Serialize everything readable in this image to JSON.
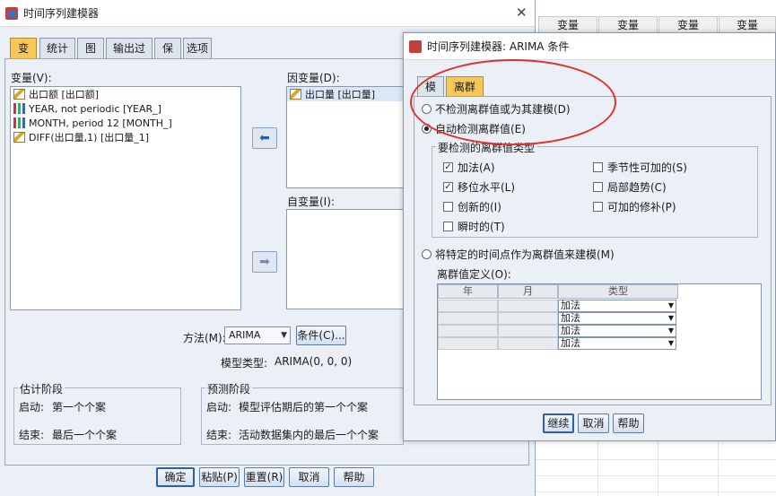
{
  "background_sheet": {
    "columns": [
      "变量",
      "变量",
      "变量",
      "变量"
    ]
  },
  "main_dialog": {
    "title": "时间序列建模器",
    "tabs": [
      "变量",
      "统计量",
      "图表",
      "输出过滤",
      "保存",
      "选项"
    ],
    "variables_label": "变量(V):",
    "variables": [
      {
        "icon": "scale-icon",
        "label": "出口额 [出口额]"
      },
      {
        "icon": "nominal-bars-icon",
        "label": "YEAR, not periodic [YEAR_]"
      },
      {
        "icon": "nominal-bars-icon",
        "label": "MONTH, period 12 [MONTH_]"
      },
      {
        "icon": "scale-icon",
        "label": "DIFF(出口量,1) [出口量_1]"
      }
    ],
    "dependent_label": "因变量(D):",
    "dependent_items": [
      "出口量 [出口量]"
    ],
    "independent_label": "自变量(I):",
    "method_label": "方法(M):",
    "method_value": "ARIMA",
    "criteria_button": "条件(C)...",
    "model_type_label": "模型类型:",
    "model_type_value": "ARIMA(0, 0, 0)",
    "estimation_group": "估计阶段",
    "estimation_start_label": "启动:",
    "estimation_start": "第一个个案",
    "estimation_end_label": "结束:",
    "estimation_end": "最后一个个案",
    "forecast_group": "预测阶段",
    "forecast_start_label": "启动:",
    "forecast_start": "模型评估期后的第一个个案",
    "forecast_end_label": "结束:",
    "forecast_end": "活动数据集内的最后一个个案",
    "buttons": [
      "确定",
      "粘贴(P)",
      "重置(R)",
      "取消",
      "帮助"
    ]
  },
  "arima_dialog": {
    "title": "时间序列建模器: ARIMA 条件",
    "tabs": [
      "模型",
      "离群值"
    ],
    "radio_no_detect": "不检测离群值或为其建模(D)",
    "radio_auto_detect": "自动检测离群值(E)",
    "types_group": "要检测的离群值类型",
    "checks": [
      {
        "label": "加法(A)",
        "checked": true
      },
      {
        "label": "季节性可加的(S)",
        "checked": false
      },
      {
        "label": "移位水平(L)",
        "checked": true
      },
      {
        "label": "局部趋势(C)",
        "checked": false
      },
      {
        "label": "创新的(I)",
        "checked": false
      },
      {
        "label": "可加的修补(P)",
        "checked": false
      },
      {
        "label": "瞬时的(T)",
        "checked": false
      }
    ],
    "radio_specific": "将特定的时间点作为离群值来建模(M)",
    "def_label": "离群值定义(O):",
    "grid_headers": [
      "年",
      "月",
      "类型"
    ],
    "grid_types": [
      "加法",
      "加法",
      "加法",
      "加法"
    ],
    "buttons": [
      "继续",
      "取消",
      "帮助"
    ]
  }
}
